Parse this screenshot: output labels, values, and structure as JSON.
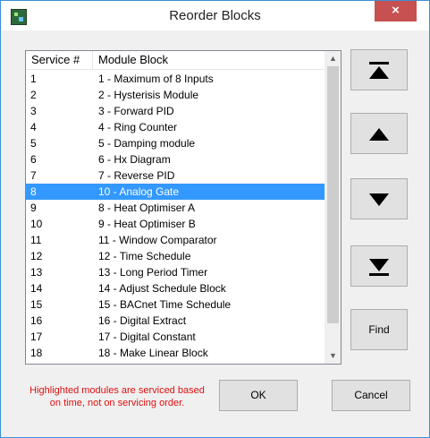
{
  "window": {
    "title": "Reorder Blocks",
    "close_label": "×"
  },
  "list": {
    "headers": {
      "service": "Service #",
      "module": "Module Block"
    },
    "rows": [
      {
        "service": "1",
        "module": "1 - Maximum of 8 Inputs"
      },
      {
        "service": "2",
        "module": "2 - Hysterisis Module"
      },
      {
        "service": "3",
        "module": "3 - Forward PID"
      },
      {
        "service": "4",
        "module": "4 - Ring Counter"
      },
      {
        "service": "5",
        "module": "5 - Damping module"
      },
      {
        "service": "6",
        "module": "6 - Hx Diagram"
      },
      {
        "service": "7",
        "module": "7 - Reverse PID"
      },
      {
        "service": "8",
        "module": "10 - Analog Gate",
        "selected": true
      },
      {
        "service": "9",
        "module": "8 - Heat Optimiser A"
      },
      {
        "service": "10",
        "module": "9 - Heat Optimiser B"
      },
      {
        "service": "11",
        "module": "11 - Window Comparator"
      },
      {
        "service": "12",
        "module": "12 - Time Schedule"
      },
      {
        "service": "13",
        "module": "13 - Long Period Timer"
      },
      {
        "service": "14",
        "module": "14 - Adjust Schedule Block"
      },
      {
        "service": "15",
        "module": "15 - BACnet Time Schedule"
      },
      {
        "service": "16",
        "module": "16 - Digital Extract"
      },
      {
        "service": "17",
        "module": "17 - Digital Constant"
      },
      {
        "service": "18",
        "module": "18 - Make Linear Block"
      }
    ]
  },
  "buttons": {
    "move_top_icon": "move-to-top-icon",
    "move_up_icon": "move-up-icon",
    "move_down_icon": "move-down-icon",
    "move_bottom_icon": "move-to-bottom-icon",
    "find": "Find",
    "ok": "OK",
    "cancel": "Cancel"
  },
  "note": "Highlighted modules are serviced based on time, not on servicing order.",
  "colors": {
    "selection": "#3399ff",
    "note": "#e01010",
    "close": "#c75050"
  }
}
